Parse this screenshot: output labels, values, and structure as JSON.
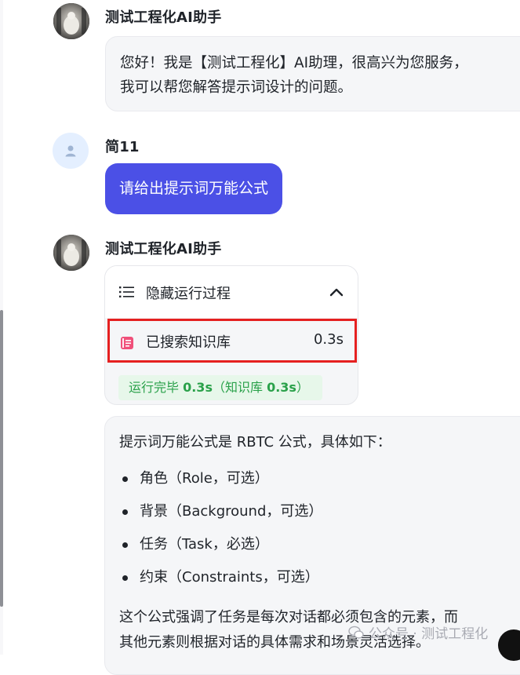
{
  "colors": {
    "accent": "#4b50e6",
    "highlight_border": "#e52020",
    "success": "#2aa14a",
    "bubble_bg": "#f5f6f8"
  },
  "messages": {
    "bot_greeting": {
      "sender": "测试工程化AI助手",
      "lines": [
        "您好！我是【测试工程化】AI助理，很高兴为您服务，",
        "我可以帮您解答提示词设计的问题。"
      ]
    },
    "user_message": {
      "sender": "简11",
      "text": "请给出提示词万能公式"
    },
    "bot_answer": {
      "sender": "测试工程化AI助手",
      "process": {
        "toggle_label": "隐藏运行过程",
        "toggle_icon": "chevron-up-icon",
        "step_label": "已搜索知识库",
        "step_time": "0.3s",
        "status_prefix": "运行完毕 ",
        "status_time": "0.3s",
        "status_open": "（知识库 ",
        "status_kb_time": "0.3s",
        "status_close": "）"
      },
      "intro": "提示词万能公式是 RBTC 公式，具体如下：",
      "items": [
        "角色（Role，可选）",
        "背景（Background，可选）",
        "任务（Task，必选）",
        "约束（Constraints，可选）"
      ],
      "summary_lines": [
        "这个公式强调了任务是每次对话都必须包含的元素，而",
        "其他元素则根据对话的具体需求和场景灵活选择。"
      ]
    }
  },
  "watermark": {
    "text": "公众号 · 测试工程化"
  }
}
